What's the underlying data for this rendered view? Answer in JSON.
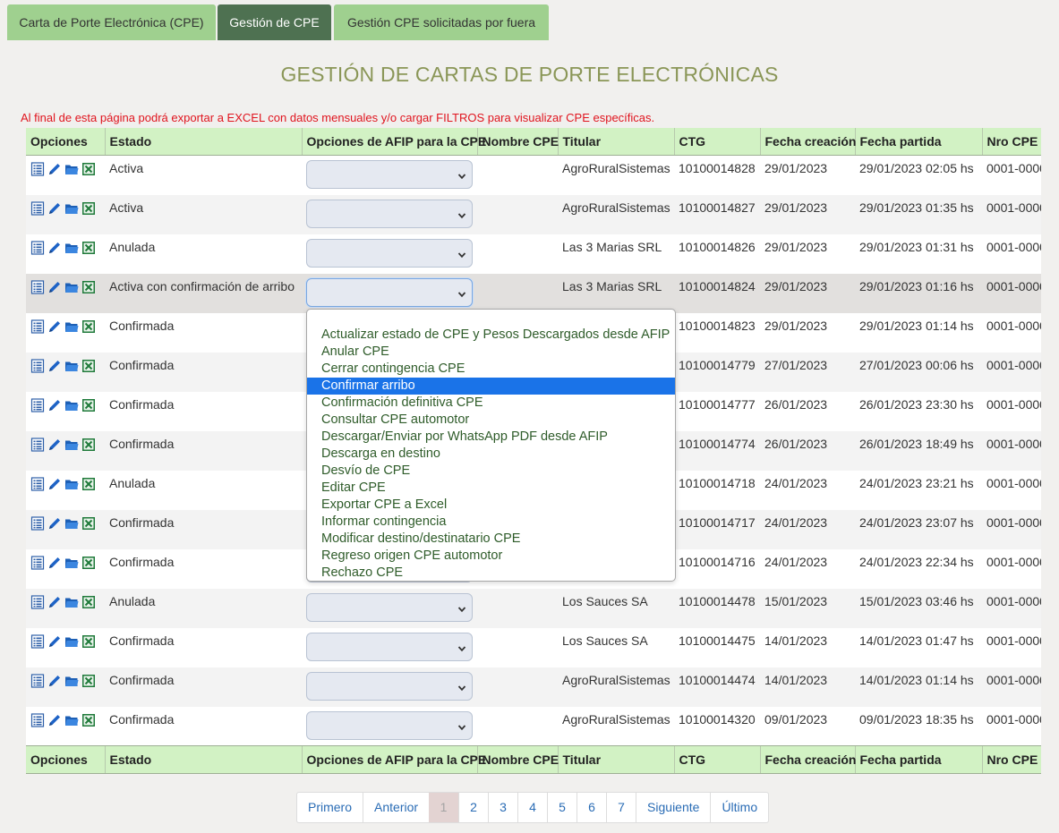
{
  "tabs": [
    {
      "label": "Carta de Porte Electrónica (CPE)"
    },
    {
      "label": "Gestión de CPE"
    },
    {
      "label": "Gestión CPE solicitadas por fuera"
    }
  ],
  "title": "GESTIÓN DE CARTAS DE PORTE ELECTRÓNICAS",
  "notice": "Al final de esta página podrá exportar a EXCEL con datos mensuales y/o cargar FILTROS para visualizar CPE específicas.",
  "columns": [
    "Opciones",
    "Estado",
    "Opciones de AFIP para la CPE",
    "Nombre CPE",
    "Titular",
    "CTG",
    "Fecha creación",
    "Fecha partida",
    "Nro CPE"
  ],
  "rows": [
    {
      "estado": "Activa",
      "nombre": "",
      "titular": "AgroRuralSistemas",
      "ctg": "10100014828",
      "creacion": "29/01/2023",
      "partida": "29/01/2023 02:05 hs",
      "nro": "0001-0000"
    },
    {
      "estado": "Activa",
      "nombre": "",
      "titular": "AgroRuralSistemas",
      "ctg": "10100014827",
      "creacion": "29/01/2023",
      "partida": "29/01/2023 01:35 hs",
      "nro": "0001-0000"
    },
    {
      "estado": "Anulada",
      "nombre": "",
      "titular": "Las 3 Marias SRL",
      "ctg": "10100014826",
      "creacion": "29/01/2023",
      "partida": "29/01/2023 01:31 hs",
      "nro": "0001-0000"
    },
    {
      "estado": "Activa con confirmación de arribo",
      "nombre": "",
      "titular": "Las 3 Marias SRL",
      "ctg": "10100014824",
      "creacion": "29/01/2023",
      "partida": "29/01/2023 01:16 hs",
      "nro": "0001-0000"
    },
    {
      "estado": "Confirmada",
      "nombre": "",
      "titular": "",
      "ctg": "10100014823",
      "creacion": "29/01/2023",
      "partida": "29/01/2023 01:14 hs",
      "nro": "0001-0000"
    },
    {
      "estado": "Confirmada",
      "nombre": "",
      "titular": "",
      "ctg": "10100014779",
      "creacion": "27/01/2023",
      "partida": "27/01/2023 00:06 hs",
      "nro": "0001-0000"
    },
    {
      "estado": "Confirmada",
      "nombre": "",
      "titular": "",
      "ctg": "10100014777",
      "creacion": "26/01/2023",
      "partida": "26/01/2023 23:30 hs",
      "nro": "0001-0000"
    },
    {
      "estado": "Confirmada",
      "nombre": "",
      "titular": "",
      "ctg": "10100014774",
      "creacion": "26/01/2023",
      "partida": "26/01/2023 18:49 hs",
      "nro": "0001-0000"
    },
    {
      "estado": "Anulada",
      "nombre": "",
      "titular": "",
      "ctg": "10100014718",
      "creacion": "24/01/2023",
      "partida": "24/01/2023 23:21 hs",
      "nro": "0001-0000"
    },
    {
      "estado": "Confirmada",
      "nombre": "",
      "titular": "",
      "ctg": "10100014717",
      "creacion": "24/01/2023",
      "partida": "24/01/2023 23:07 hs",
      "nro": "0001-0000"
    },
    {
      "estado": "Confirmada",
      "nombre": "",
      "titular": "",
      "ctg": "10100014716",
      "creacion": "24/01/2023",
      "partida": "24/01/2023 22:34 hs",
      "nro": "0001-0000"
    },
    {
      "estado": "Anulada",
      "nombre": "",
      "titular": "Los Sauces SA",
      "ctg": "10100014478",
      "creacion": "15/01/2023",
      "partida": "15/01/2023 03:46 hs",
      "nro": "0001-0000"
    },
    {
      "estado": "Confirmada",
      "nombre": "",
      "titular": "Los Sauces SA",
      "ctg": "10100014475",
      "creacion": "14/01/2023",
      "partida": "14/01/2023 01:47 hs",
      "nro": "0001-0000"
    },
    {
      "estado": "Confirmada",
      "nombre": "",
      "titular": "AgroRuralSistemas",
      "ctg": "10100014474",
      "creacion": "14/01/2023",
      "partida": "14/01/2023 01:14 hs",
      "nro": "0001-0000"
    },
    {
      "estado": "Confirmada",
      "nombre": "",
      "titular": "AgroRuralSistemas",
      "ctg": "10100014320",
      "creacion": "09/01/2023",
      "partida": "09/01/2023 18:35 hs",
      "nro": "0001-0000"
    }
  ],
  "icons": [
    "list-icon",
    "pencil-icon",
    "folder-icon",
    "excel-icon"
  ],
  "dropdown": {
    "options": [
      "Actualizar estado de CPE y Pesos Descargados desde AFIP",
      "Anular CPE",
      "Cerrar contingencia CPE",
      "Confirmar arribo",
      "Confirmación definitiva CPE",
      "Consultar CPE automotor",
      "Descargar/Enviar por WhatsApp PDF desde AFIP",
      "Descarga en destino",
      "Desvío de CPE",
      "Editar CPE",
      "Exportar CPE a Excel",
      "Informar contingencia",
      "Modificar destino/destinatario CPE",
      "Regreso origen CPE automotor",
      "Rechazo CPE"
    ],
    "highlighted": "Confirmar arribo"
  },
  "pagination": {
    "first": "Primero",
    "prev": "Anterior",
    "pages": [
      "1",
      "2",
      "3",
      "4",
      "5",
      "6",
      "7"
    ],
    "current": "1",
    "next": "Siguiente",
    "last": "Último"
  },
  "colors": {
    "tab": "#9fd08f",
    "tab_active": "#4e7151",
    "header": "#d2f2c4",
    "title": "#8a9657",
    "notice": "#e0141e",
    "option_text": "#2f5c2a",
    "highlight": "#1a73e8"
  }
}
